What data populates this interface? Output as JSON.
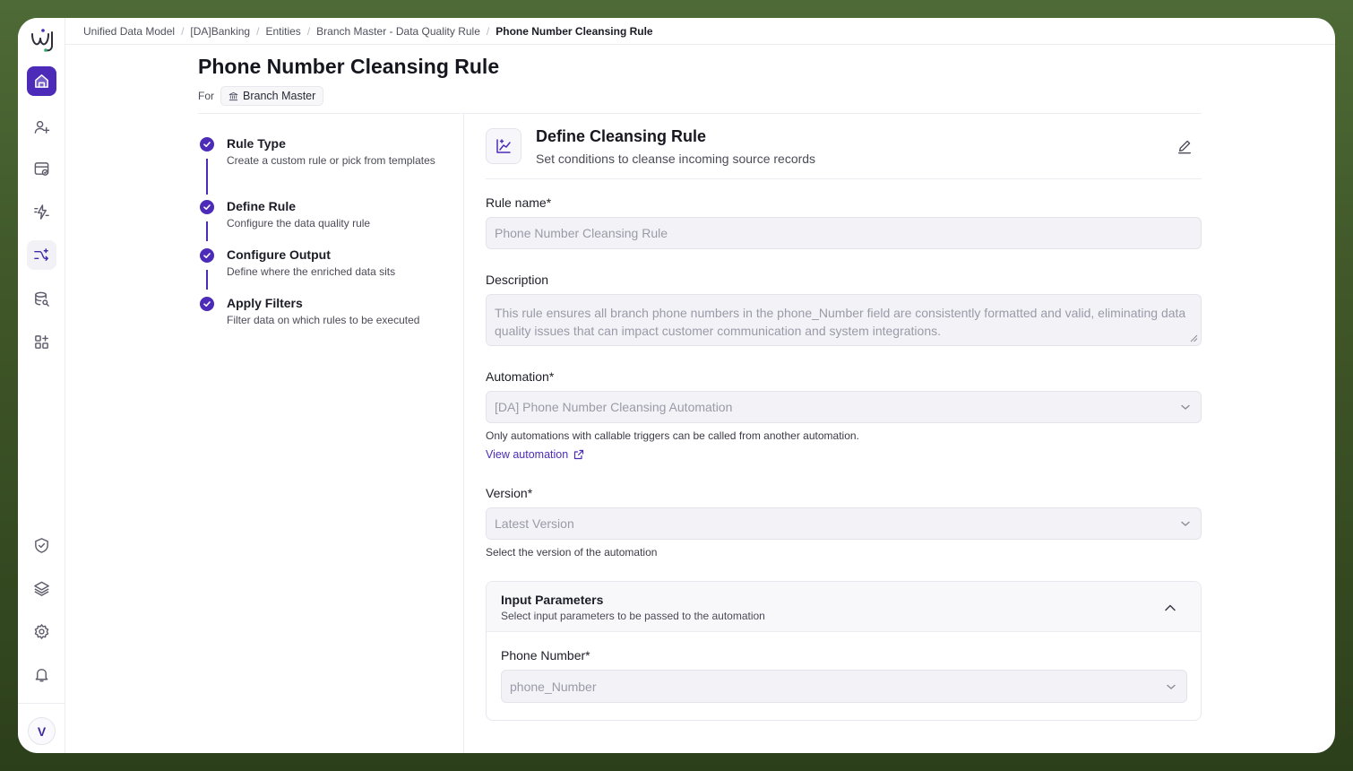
{
  "breadcrumb": {
    "items": [
      "Unified Data Model",
      "[DA]Banking",
      "Entities",
      "Branch Master - Data Quality Rule"
    ],
    "current": "Phone Number Cleansing Rule",
    "separator": "/"
  },
  "header": {
    "title": "Phone Number Cleansing Rule",
    "for_label": "For",
    "entity": "Branch Master"
  },
  "sidebar": {
    "avatar_initial": "V",
    "icons": [
      "logo-icon",
      "home-icon",
      "user-sparkle-icon",
      "calendar-form-icon",
      "lightning-icon",
      "flow-sparkle-icon",
      "database-search-icon",
      "apps-grid-icon",
      "shield-icon",
      "layers-icon",
      "gear-icon",
      "bell-icon"
    ]
  },
  "steps": [
    {
      "title": "Rule Type",
      "desc": "Create a custom rule or pick from templates",
      "status": "done"
    },
    {
      "title": "Define Rule",
      "desc": "Configure the data quality rule",
      "status": "done"
    },
    {
      "title": "Configure Output",
      "desc": "Define where the enriched data sits",
      "status": "done"
    },
    {
      "title": "Apply Filters",
      "desc": "Filter data on which rules to be executed",
      "status": "done"
    }
  ],
  "panel": {
    "title": "Define Cleansing Rule",
    "subtitle": "Set conditions to cleanse incoming source records"
  },
  "form": {
    "rule_name_label": "Rule name*",
    "rule_name_value": "Phone Number Cleansing Rule",
    "description_label": "Description",
    "description_value": "This rule ensures all branch phone numbers in the phone_Number field are consistently formatted and valid, eliminating data quality issues that can impact customer communication and system integrations.",
    "automation_label": "Automation*",
    "automation_value": "[DA] Phone Number Cleansing Automation",
    "automation_help": "Only automations with callable triggers can be called from another automation.",
    "view_automation_link": "View automation",
    "version_label": "Version*",
    "version_value": "Latest Version",
    "version_help": "Select the version of the automation"
  },
  "input_parameters": {
    "title": "Input Parameters",
    "subtitle": "Select input parameters to be passed to the automation",
    "expanded": true,
    "field_label": "Phone Number*",
    "field_value": "phone_Number"
  },
  "colors": {
    "accent": "#4b2bb8",
    "background_outer": "#3f5628"
  }
}
